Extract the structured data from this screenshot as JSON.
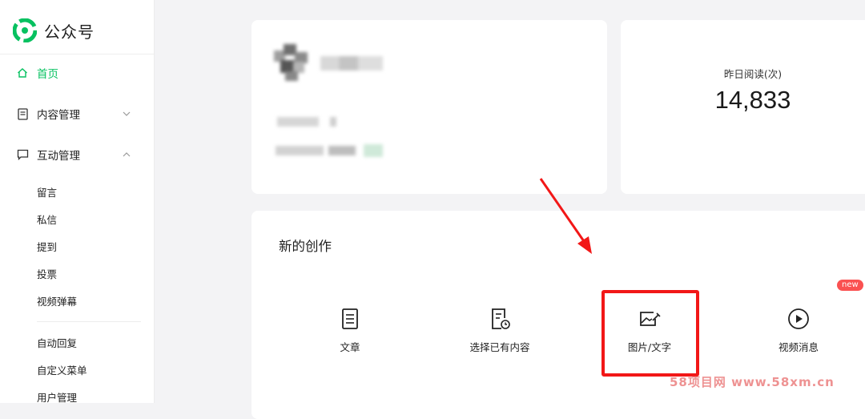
{
  "app": {
    "title": "公众号"
  },
  "sidebar": {
    "home": "首页",
    "content_mgmt": "内容管理",
    "interaction_mgmt": "互动管理",
    "sub_items": [
      "留言",
      "私信",
      "提到",
      "投票",
      "视频弹幕"
    ],
    "sub_items_2": [
      "自动回复",
      "自定义菜单",
      "用户管理"
    ]
  },
  "stats": {
    "label": "昨日阅读(次)",
    "value": "14,833"
  },
  "create": {
    "title": "新的创作",
    "options": [
      "文章",
      "选择已有内容",
      "图片/文字",
      "视频消息"
    ],
    "badge": "new"
  },
  "watermark": "58项目网 www.58xm.cn",
  "colors": {
    "accent": "#07c160",
    "annotation": "#f21717",
    "badge": "#fa5151"
  }
}
